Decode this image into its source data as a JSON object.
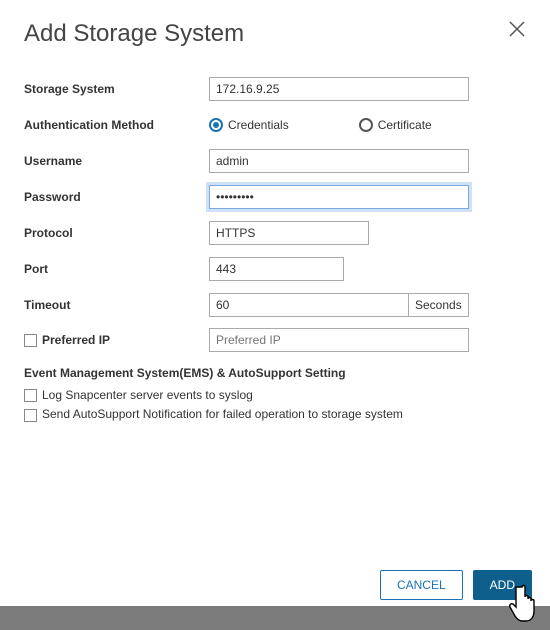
{
  "dialog": {
    "title": "Add Storage System"
  },
  "labels": {
    "storage_system": "Storage System",
    "auth_method": "Authentication Method",
    "username": "Username",
    "password": "Password",
    "protocol": "Protocol",
    "port": "Port",
    "timeout": "Timeout",
    "preferred_ip": "Preferred IP",
    "seconds": "Seconds",
    "ems_section": "Event Management System(EMS) & AutoSupport Setting"
  },
  "auth": {
    "credentials_label": "Credentials",
    "certificate_label": "Certificate"
  },
  "values": {
    "storage_system": "172.16.9.25",
    "username": "admin",
    "password": "•••••••••",
    "protocol": "HTTPS",
    "port": "443",
    "timeout": "60",
    "preferred_ip_placeholder": "Preferred IP"
  },
  "checkboxes": {
    "log_syslog": "Log Snapcenter server events to syslog",
    "send_autosupport": "Send AutoSupport Notification for failed operation to storage system"
  },
  "buttons": {
    "cancel": "CANCEL",
    "add": "ADD"
  }
}
